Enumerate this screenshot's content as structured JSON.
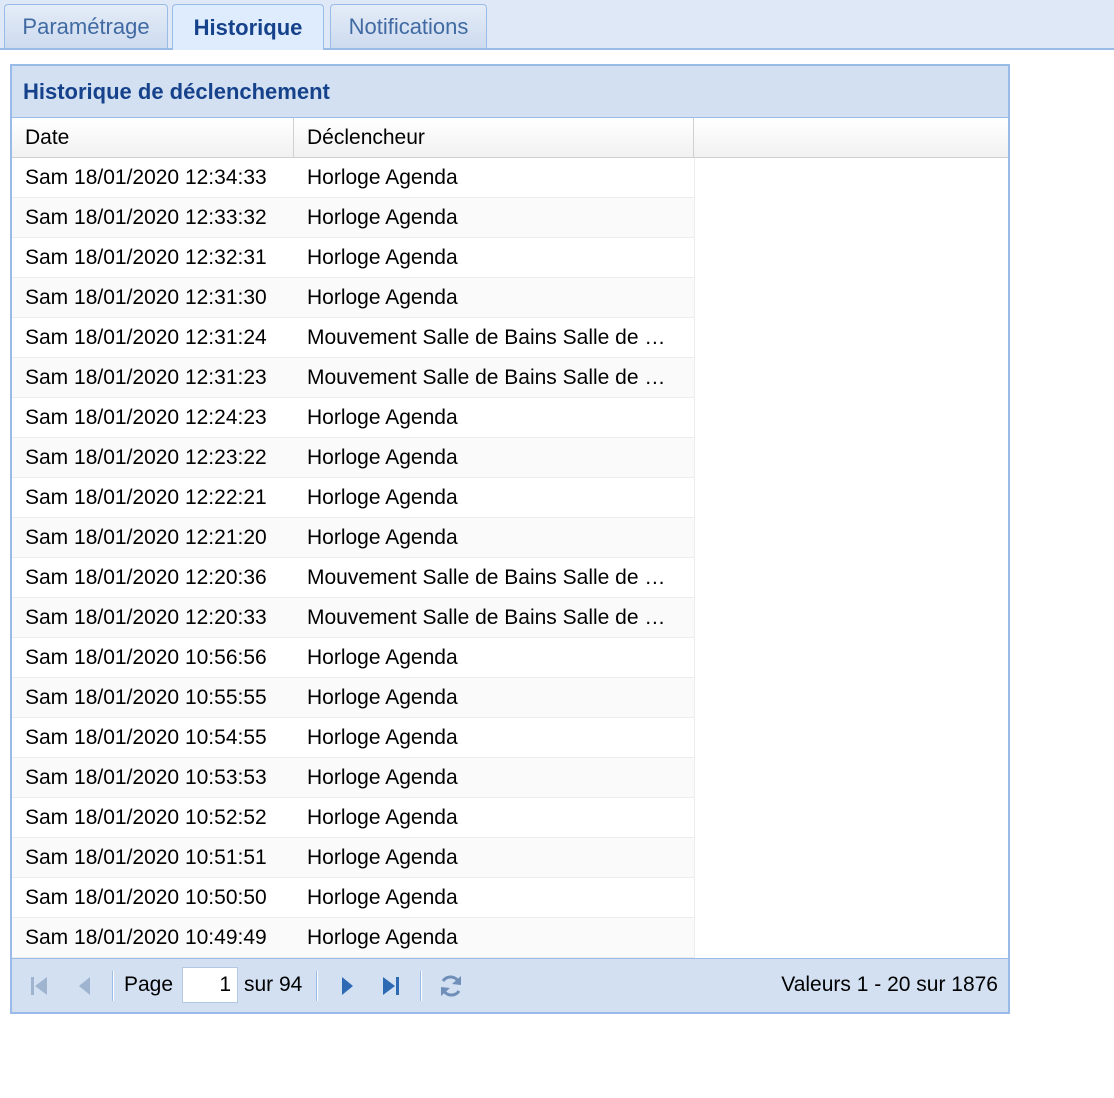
{
  "tabs": [
    {
      "label": "Paramétrage",
      "active": false
    },
    {
      "label": "Historique",
      "active": true
    },
    {
      "label": "Notifications",
      "active": false
    }
  ],
  "panel": {
    "title": "Historique de déclenchement"
  },
  "grid": {
    "columns": [
      "Date",
      "Déclencheur"
    ],
    "rows": [
      {
        "date": "Sam 18/01/2020 12:34:33",
        "trigger": "Horloge Agenda"
      },
      {
        "date": "Sam 18/01/2020 12:33:32",
        "trigger": "Horloge Agenda"
      },
      {
        "date": "Sam 18/01/2020 12:32:31",
        "trigger": "Horloge Agenda"
      },
      {
        "date": "Sam 18/01/2020 12:31:30",
        "trigger": "Horloge Agenda"
      },
      {
        "date": "Sam 18/01/2020 12:31:24",
        "trigger": "Mouvement Salle de Bains Salle de …"
      },
      {
        "date": "Sam 18/01/2020 12:31:23",
        "trigger": "Mouvement Salle de Bains Salle de …"
      },
      {
        "date": "Sam 18/01/2020 12:24:23",
        "trigger": "Horloge Agenda"
      },
      {
        "date": "Sam 18/01/2020 12:23:22",
        "trigger": "Horloge Agenda"
      },
      {
        "date": "Sam 18/01/2020 12:22:21",
        "trigger": "Horloge Agenda"
      },
      {
        "date": "Sam 18/01/2020 12:21:20",
        "trigger": "Horloge Agenda"
      },
      {
        "date": "Sam 18/01/2020 12:20:36",
        "trigger": "Mouvement Salle de Bains Salle de …"
      },
      {
        "date": "Sam 18/01/2020 12:20:33",
        "trigger": "Mouvement Salle de Bains Salle de …"
      },
      {
        "date": "Sam 18/01/2020 10:56:56",
        "trigger": "Horloge Agenda"
      },
      {
        "date": "Sam 18/01/2020 10:55:55",
        "trigger": "Horloge Agenda"
      },
      {
        "date": "Sam 18/01/2020 10:54:55",
        "trigger": "Horloge Agenda"
      },
      {
        "date": "Sam 18/01/2020 10:53:53",
        "trigger": "Horloge Agenda"
      },
      {
        "date": "Sam 18/01/2020 10:52:52",
        "trigger": "Horloge Agenda"
      },
      {
        "date": "Sam 18/01/2020 10:51:51",
        "trigger": "Horloge Agenda"
      },
      {
        "date": "Sam 18/01/2020 10:50:50",
        "trigger": "Horloge Agenda"
      },
      {
        "date": "Sam 18/01/2020 10:49:49",
        "trigger": "Horloge Agenda"
      }
    ]
  },
  "pager": {
    "page_label": "Page",
    "current_page": "1",
    "of_label": "sur 94",
    "display_info": "Valeurs 1 - 20 sur 1876"
  },
  "icons": {
    "first": "first-page-icon",
    "prev": "previous-page-icon",
    "next": "next-page-icon",
    "last": "last-page-icon",
    "refresh": "refresh-icon"
  },
  "colors": {
    "header_bg": "#d2e0f2",
    "title_text": "#15428b",
    "border": "#99bbe8",
    "tab_text": "#416aa3",
    "icon": "#2e6ab3",
    "icon_disabled": "#9fb4cf"
  }
}
